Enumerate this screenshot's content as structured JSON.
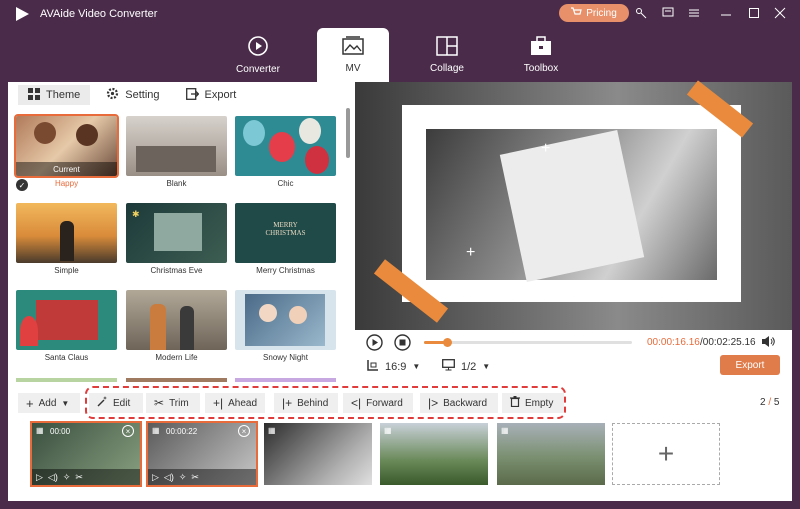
{
  "app": {
    "title": "AVAide Video Converter",
    "pricing_label": "Pricing"
  },
  "nav": {
    "tabs": [
      {
        "label": "Converter",
        "icon": "converter-icon"
      },
      {
        "label": "MV",
        "icon": "mv-icon",
        "active": true
      },
      {
        "label": "Collage",
        "icon": "collage-icon"
      },
      {
        "label": "Toolbox",
        "icon": "toolbox-icon"
      }
    ]
  },
  "subtabs": [
    {
      "label": "Theme",
      "active": true
    },
    {
      "label": "Setting"
    },
    {
      "label": "Export"
    }
  ],
  "themes": [
    {
      "label": "Happy",
      "selected": true,
      "badge": "Current"
    },
    {
      "label": "Blank"
    },
    {
      "label": "Chic"
    },
    {
      "label": "Simple"
    },
    {
      "label": "Christmas Eve"
    },
    {
      "label": "Merry Christmas"
    },
    {
      "label": "Santa Claus"
    },
    {
      "label": "Modern Life"
    },
    {
      "label": "Snowy Night"
    }
  ],
  "player": {
    "current_time": "00:00:16.16",
    "total_time": "/00:02:25.16",
    "progress": 0.11,
    "aspect": "16:9",
    "page": "1/2",
    "export_label": "Export"
  },
  "toolbar": {
    "add": "Add",
    "edit": "Edit",
    "trim": "Trim",
    "ahead": "Ahead",
    "behind": "Behind",
    "forward": "Forward",
    "backward": "Backward",
    "empty": "Empty"
  },
  "clips": {
    "page_current": "2",
    "page_total": "5",
    "items": [
      {
        "time": "00:00",
        "selected": true
      },
      {
        "time": "00:00:22",
        "selected": true
      },
      {
        "time": ""
      },
      {
        "time": ""
      },
      {
        "time": ""
      }
    ]
  },
  "colors": {
    "accent": "#e76b3b",
    "titlebar": "#4a2c4a",
    "highlight": "#e03c3c"
  }
}
